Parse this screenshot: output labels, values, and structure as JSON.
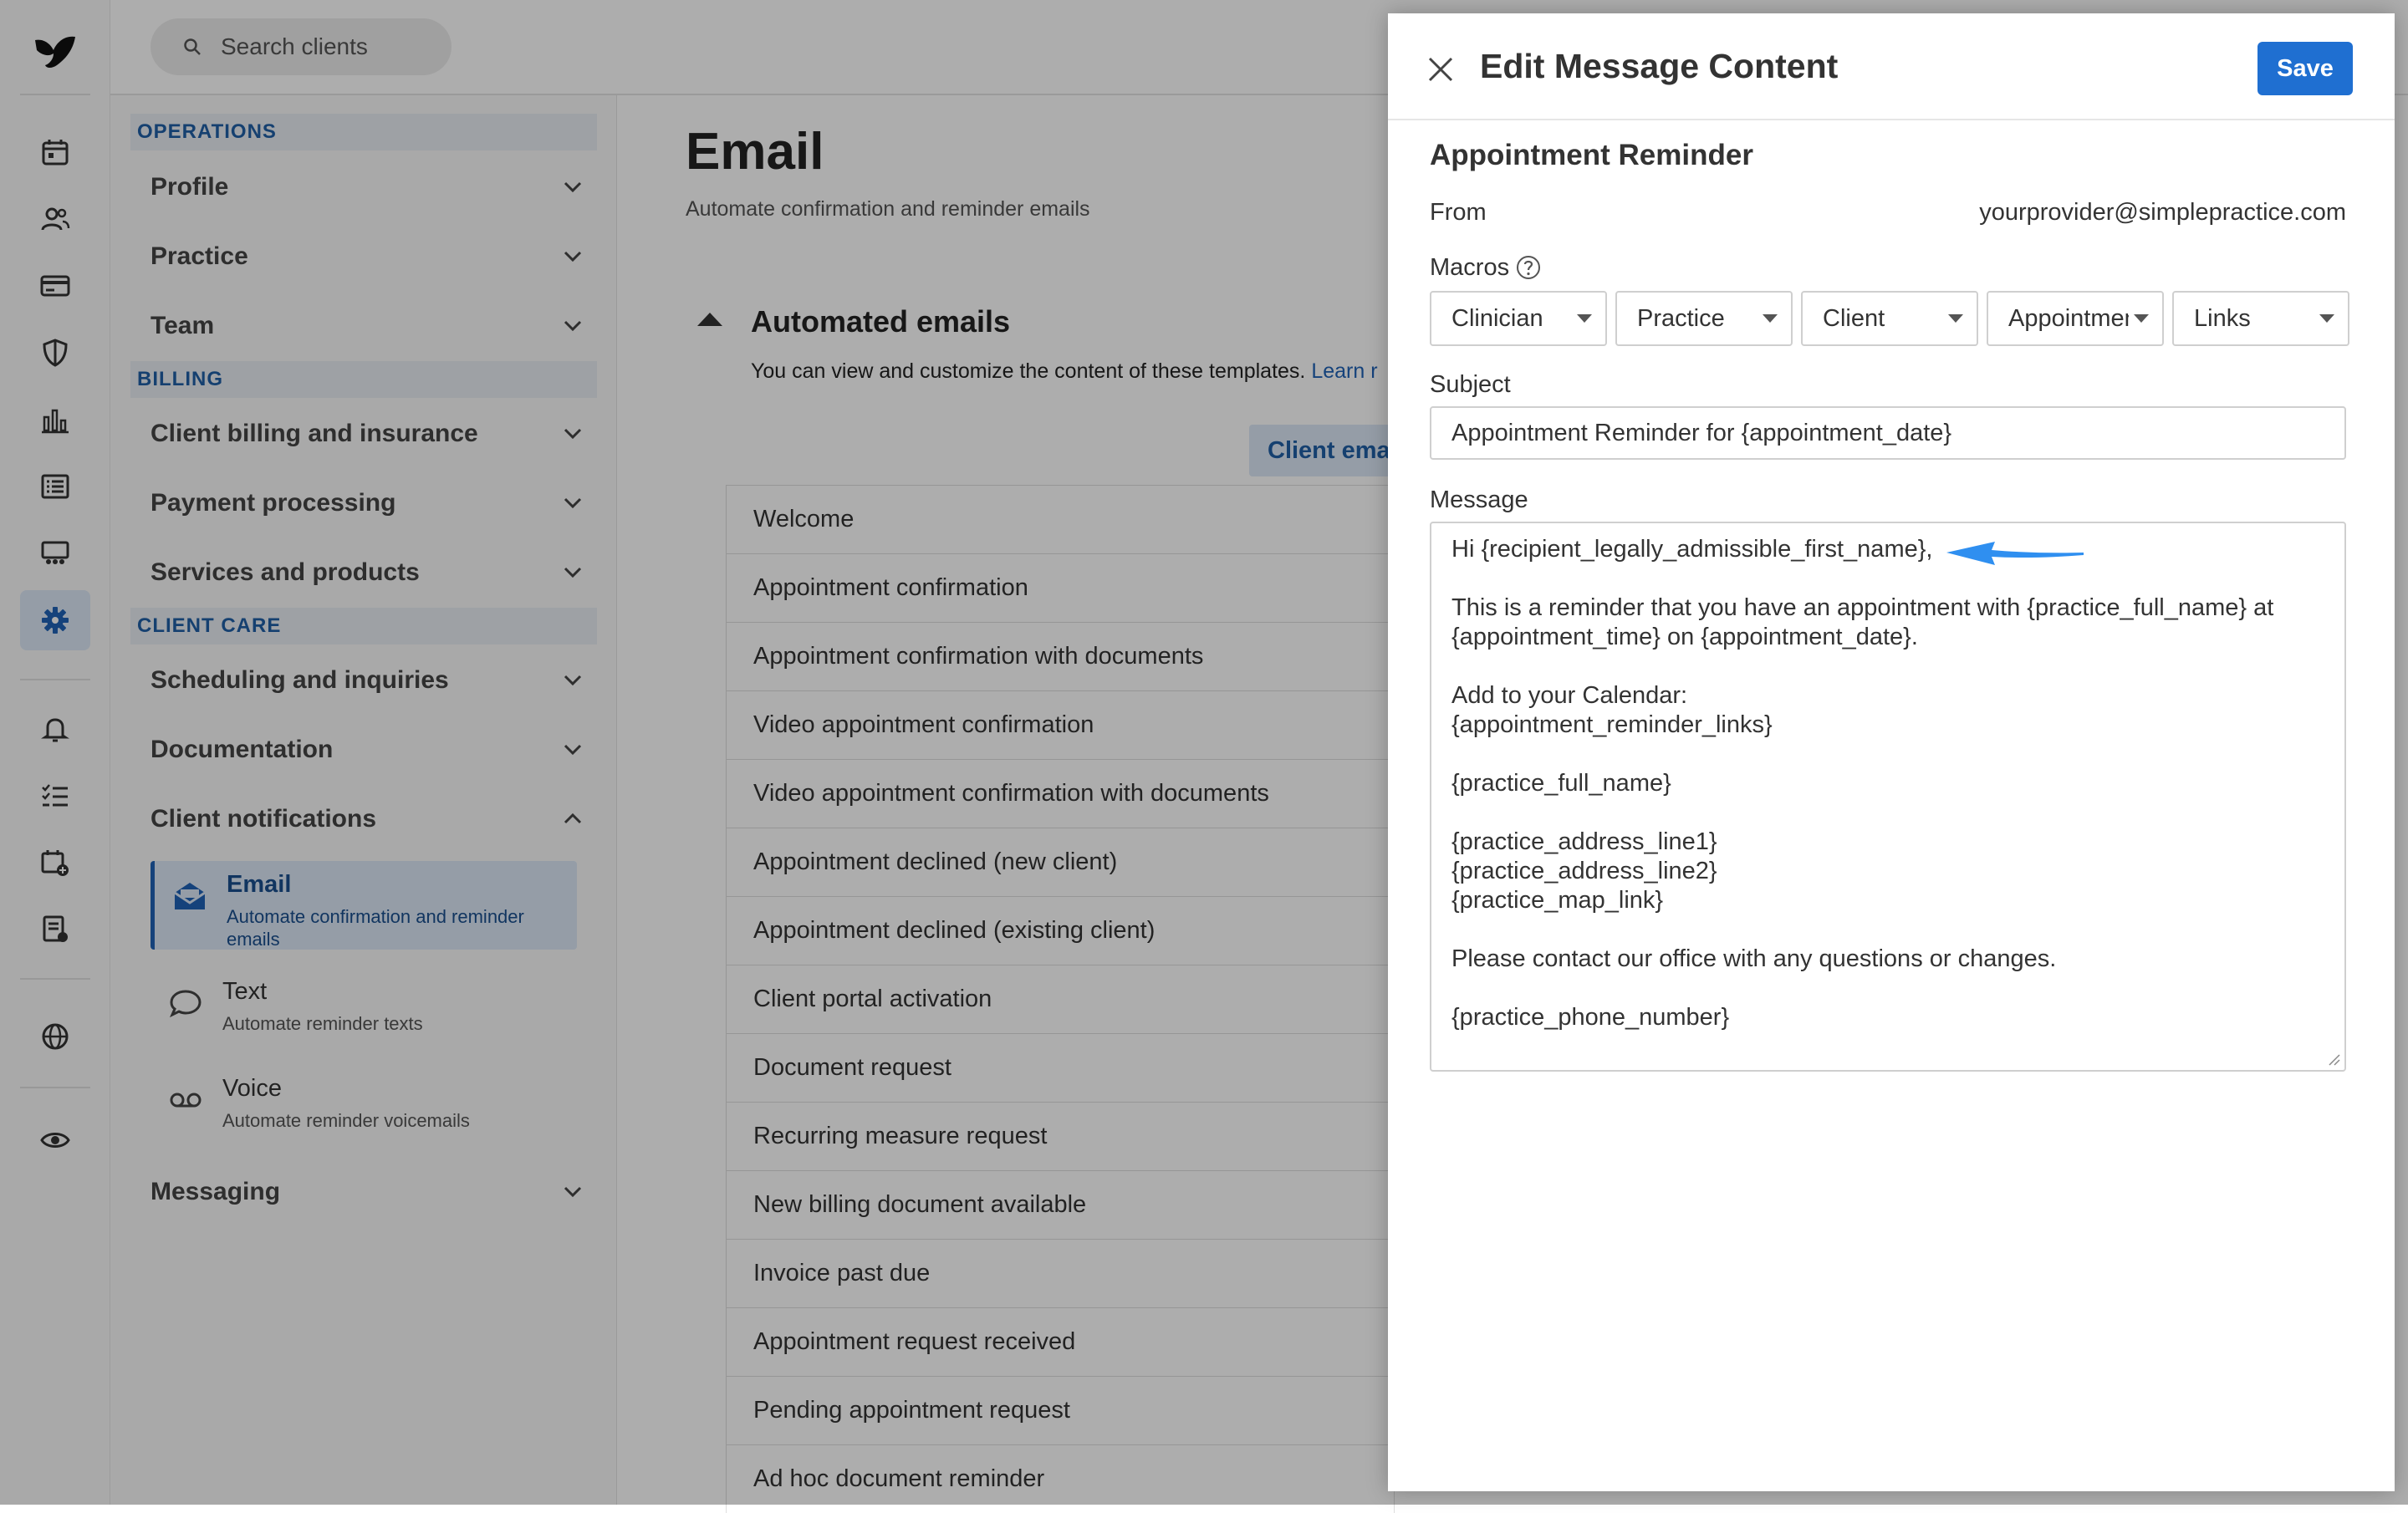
{
  "rail": {
    "logo_icon": "simplepractice-logo",
    "icons": [
      "calendar-icon",
      "clients-icon",
      "billing-card-icon",
      "shield-icon",
      "analytics-icon",
      "activity-list-icon",
      "marketplace-icon",
      "settings-gear-icon",
      "bell-icon",
      "tasks-icon",
      "calendar-add-icon",
      "reports-icon",
      "globe-icon",
      "eye-icon"
    ],
    "active": "settings-gear-icon"
  },
  "search": {
    "placeholder": "Search clients"
  },
  "nav": {
    "operations_header": "OPERATIONS",
    "profile": "Profile",
    "practice": "Practice",
    "team": "Team",
    "billing_header": "BILLING",
    "client_billing": "Client billing and insurance",
    "payment_processing": "Payment processing",
    "services": "Services and products",
    "client_care_header": "CLIENT CARE",
    "scheduling": "Scheduling and inquiries",
    "documentation": "Documentation",
    "client_notifications": "Client notifications",
    "sub": {
      "email_title": "Email",
      "email_desc": "Automate confirmation and reminder emails",
      "text_title": "Text",
      "text_desc": "Automate reminder texts",
      "voice_title": "Voice",
      "voice_desc": "Automate reminder voicemails"
    },
    "messaging": "Messaging"
  },
  "main": {
    "title": "Email",
    "subtitle": "Automate confirmation and reminder emails",
    "section_title": "Automated emails",
    "section_desc": "You can view and customize the content of these templates.",
    "learn_link": "Learn r",
    "tab": "Client ema",
    "templates": [
      "Welcome",
      "Appointment confirmation",
      "Appointment confirmation with documents",
      "Video appointment confirmation",
      "Video appointment confirmation with documents",
      "Appointment declined (new client)",
      "Appointment declined (existing client)",
      "Client portal activation",
      "Document request",
      "Recurring measure request",
      "New billing document available",
      "Invoice past due",
      "Appointment request received",
      "Pending appointment request",
      "Ad hoc document reminder"
    ]
  },
  "panel": {
    "title": "Edit Message Content",
    "save": "Save",
    "template_name": "Appointment Reminder",
    "from_label": "From",
    "from_value": "yourprovider@simplepractice.com",
    "macros_label": "Macros",
    "macros": [
      "Clinician",
      "Practice",
      "Client",
      "Appointment",
      "Links"
    ],
    "subject_label": "Subject",
    "subject_value": "Appointment Reminder for {appointment_date}",
    "message_label": "Message",
    "message_lines": [
      "Hi {recipient_legally_admissible_first_name},",
      "",
      "This is a reminder that you have an appointment with {practice_full_name} at",
      "{appointment_time} on {appointment_date}.",
      "",
      "Add to your Calendar:",
      "{appointment_reminder_links}",
      "",
      "{practice_full_name}",
      "",
      "{practice_address_line1}",
      "{practice_address_line2}",
      "{practice_map_link}",
      "",
      "Please contact our office with any questions or changes.",
      "",
      "{practice_phone_number}"
    ],
    "annotation_color": "#2f8ff0"
  }
}
